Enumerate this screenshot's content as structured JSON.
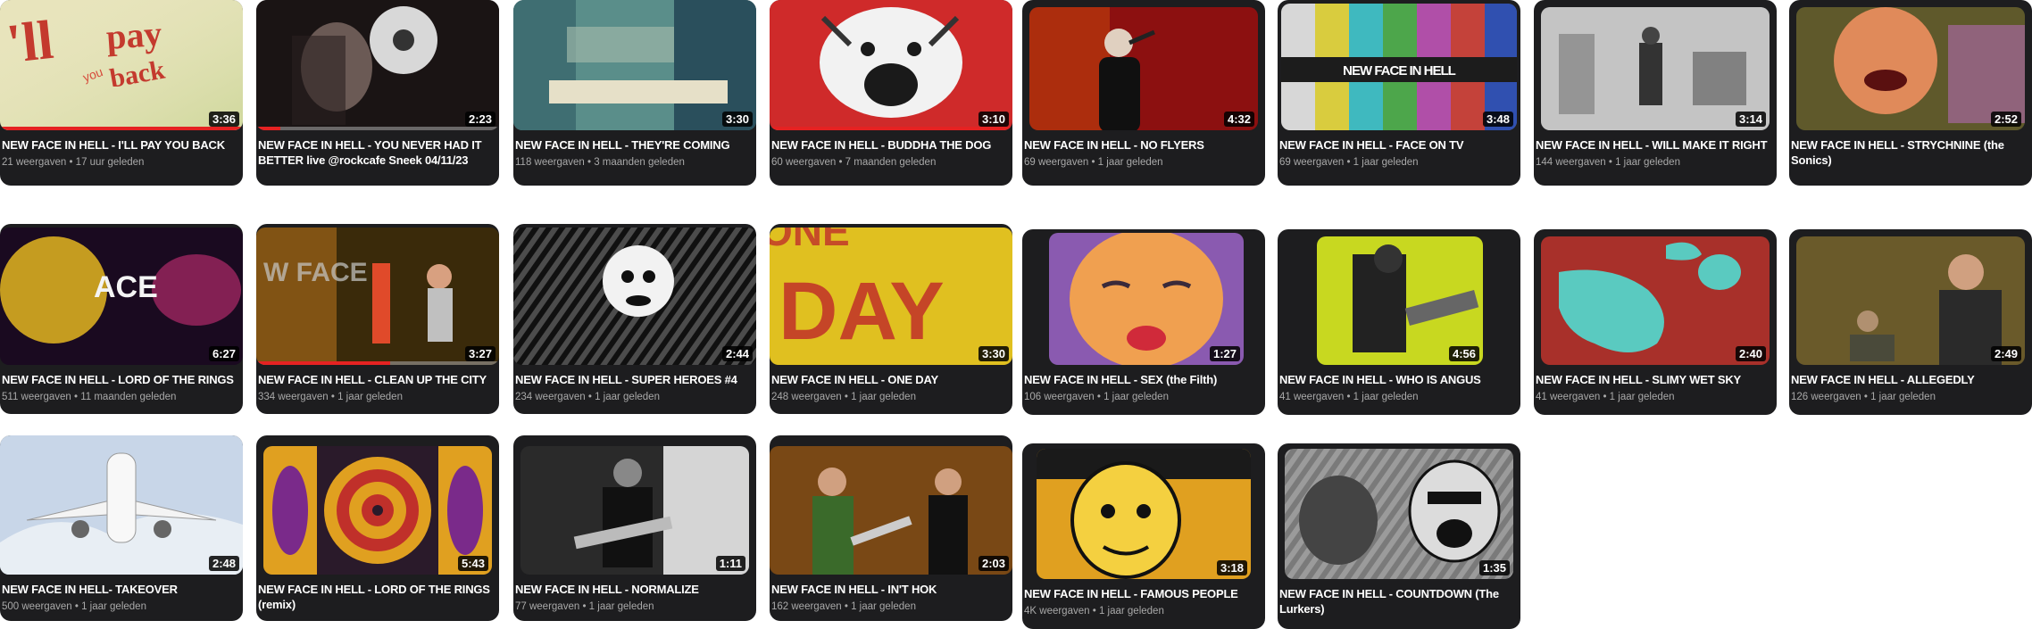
{
  "videos": [
    {
      "title": "NEW FACE IN HELL - I'LL PAY YOU BACK",
      "duration": "3:36",
      "views": "21 weergaven",
      "age": "17 uur geleden",
      "progress_fraction": 1.0,
      "thumb_text": "I'll pay you back",
      "icon": "thumbnail-graffiti"
    },
    {
      "title": "NEW FACE IN HELL - YOU NEVER HAD IT BETTER live @rockcafe Sneek 04/11/23",
      "duration": "2:23",
      "views": "",
      "age": "",
      "progress_fraction": 0.1,
      "thumb_text": "",
      "icon": "thumbnail-megaphone"
    },
    {
      "title": "NEW FACE IN HELL - THEY'RE COMING",
      "duration": "3:30",
      "views": "118 weergaven",
      "age": "3 maanden geleden",
      "progress_fraction": 0,
      "thumb_text": "",
      "icon": "thumbnail-synth"
    },
    {
      "title": "NEW FACE IN HELL - BUDDHA THE DOG",
      "duration": "3:10",
      "views": "60 weergaven",
      "age": "7 maanden geleden",
      "progress_fraction": 1.0,
      "thumb_text": "",
      "icon": "thumbnail-dog"
    },
    {
      "title": "NEW FACE IN HELL - NO FLYERS",
      "duration": "4:32",
      "views": "69 weergaven",
      "age": "1 jaar geleden",
      "progress_fraction": 0,
      "thumb_text": "",
      "icon": "thumbnail-singer"
    },
    {
      "title": "NEW FACE IN HELL - FACE ON TV",
      "duration": "3:48",
      "views": "69 weergaven",
      "age": "1 jaar geleden",
      "progress_fraction": 0,
      "thumb_text": "NEW FACE IN HELL",
      "icon": "thumbnail-testcard"
    },
    {
      "title": "NEW FACE IN HELL - WILL MAKE IT RIGHT",
      "duration": "3:14",
      "views": "144 weergaven",
      "age": "1 jaar geleden",
      "progress_fraction": 0,
      "thumb_text": "",
      "icon": "thumbnail-band"
    },
    {
      "title": "NEW FACE IN HELL - STRYCHNINE (the Sonics)",
      "duration": "2:52",
      "views": "",
      "age": "",
      "progress_fraction": 0,
      "thumb_text": "",
      "icon": "thumbnail-face"
    },
    {
      "title": "NEW FACE IN HELL - LORD OF THE RINGS",
      "duration": "6:27",
      "views": "511 weergaven",
      "age": "11 maanden geleden",
      "progress_fraction": 0,
      "thumb_text": "ACE",
      "icon": "thumbnail-stage"
    },
    {
      "title": "NEW FACE IN HELL - CLEAN UP THE CITY",
      "duration": "3:27",
      "views": "334 weergaven",
      "age": "1 jaar geleden",
      "progress_fraction": 0.55,
      "thumb_text": "W FACE",
      "icon": "thumbnail-band-live"
    },
    {
      "title": "NEW FACE IN HELL - SUPER HEROES #4",
      "duration": "2:44",
      "views": "234 weergaven",
      "age": "1 jaar geleden",
      "progress_fraction": 0,
      "thumb_text": "",
      "icon": "thumbnail-comic"
    },
    {
      "title": "NEW FACE IN HELL - ONE DAY",
      "duration": "3:30",
      "views": "248 weergaven",
      "age": "1 jaar geleden",
      "progress_fraction": 0,
      "thumb_text": "DAY",
      "icon": "thumbnail-lettering"
    },
    {
      "title": "NEW FACE IN HELL - SEX (the Filth)",
      "duration": "1:27",
      "views": "106 weergaven",
      "age": "1 jaar geleden",
      "progress_fraction": 0,
      "thumb_text": "",
      "icon": "thumbnail-popart-face"
    },
    {
      "title": "NEW FACE IN HELL - WHO IS ANGUS",
      "duration": "4:56",
      "views": "41 weergaven",
      "age": "1 jaar geleden",
      "progress_fraction": 0,
      "thumb_text": "",
      "icon": "thumbnail-guitarist"
    },
    {
      "title": "NEW FACE IN HELL - SLIMY WET SKY",
      "duration": "2:40",
      "views": "41 weergaven",
      "age": "1 jaar geleden",
      "progress_fraction": 0,
      "thumb_text": "",
      "icon": "thumbnail-abstract"
    },
    {
      "title": "NEW FACE IN HELL - ALLEGEDLY",
      "duration": "2:49",
      "views": "126 weergaven",
      "age": "1 jaar geleden",
      "progress_fraction": 0,
      "thumb_text": "",
      "icon": "thumbnail-rehearsal"
    },
    {
      "title": "NEW FACE IN HELL- TAKEOVER",
      "duration": "2:48",
      "views": "500 weergaven",
      "age": "1 jaar geleden",
      "progress_fraction": 0,
      "thumb_text": "",
      "icon": "thumbnail-airplane"
    },
    {
      "title": "NEW FACE IN HELL - LORD OF THE RINGS (remix)",
      "duration": "5:43",
      "views": "",
      "age": "",
      "progress_fraction": 0,
      "thumb_text": "",
      "icon": "thumbnail-rings"
    },
    {
      "title": "NEW FACE IN HELL - NORMALIZE",
      "duration": "1:11",
      "views": "77 weergaven",
      "age": "1 jaar geleden",
      "progress_fraction": 0,
      "thumb_text": "",
      "icon": "thumbnail-guitar-bw"
    },
    {
      "title": "NEW FACE IN HELL - IN'T HOK",
      "duration": "2:03",
      "views": "162 weergaven",
      "age": "1 jaar geleden",
      "progress_fraction": 0,
      "thumb_text": "",
      "icon": "thumbnail-duo"
    },
    {
      "title": "NEW FACE IN HELL - FAMOUS PEOPLE",
      "duration": "3:18",
      "views": "4K weergaven",
      "age": "1 jaar geleden",
      "progress_fraction": 0,
      "thumb_text": "",
      "icon": "thumbnail-cartoon-face"
    },
    {
      "title": "NEW FACE IN HELL - COUNTDOWN (The Lurkers)",
      "duration": "1:35",
      "views": "",
      "age": "",
      "progress_fraction": 0,
      "thumb_text": "",
      "icon": "thumbnail-cartoon-sketch"
    }
  ]
}
